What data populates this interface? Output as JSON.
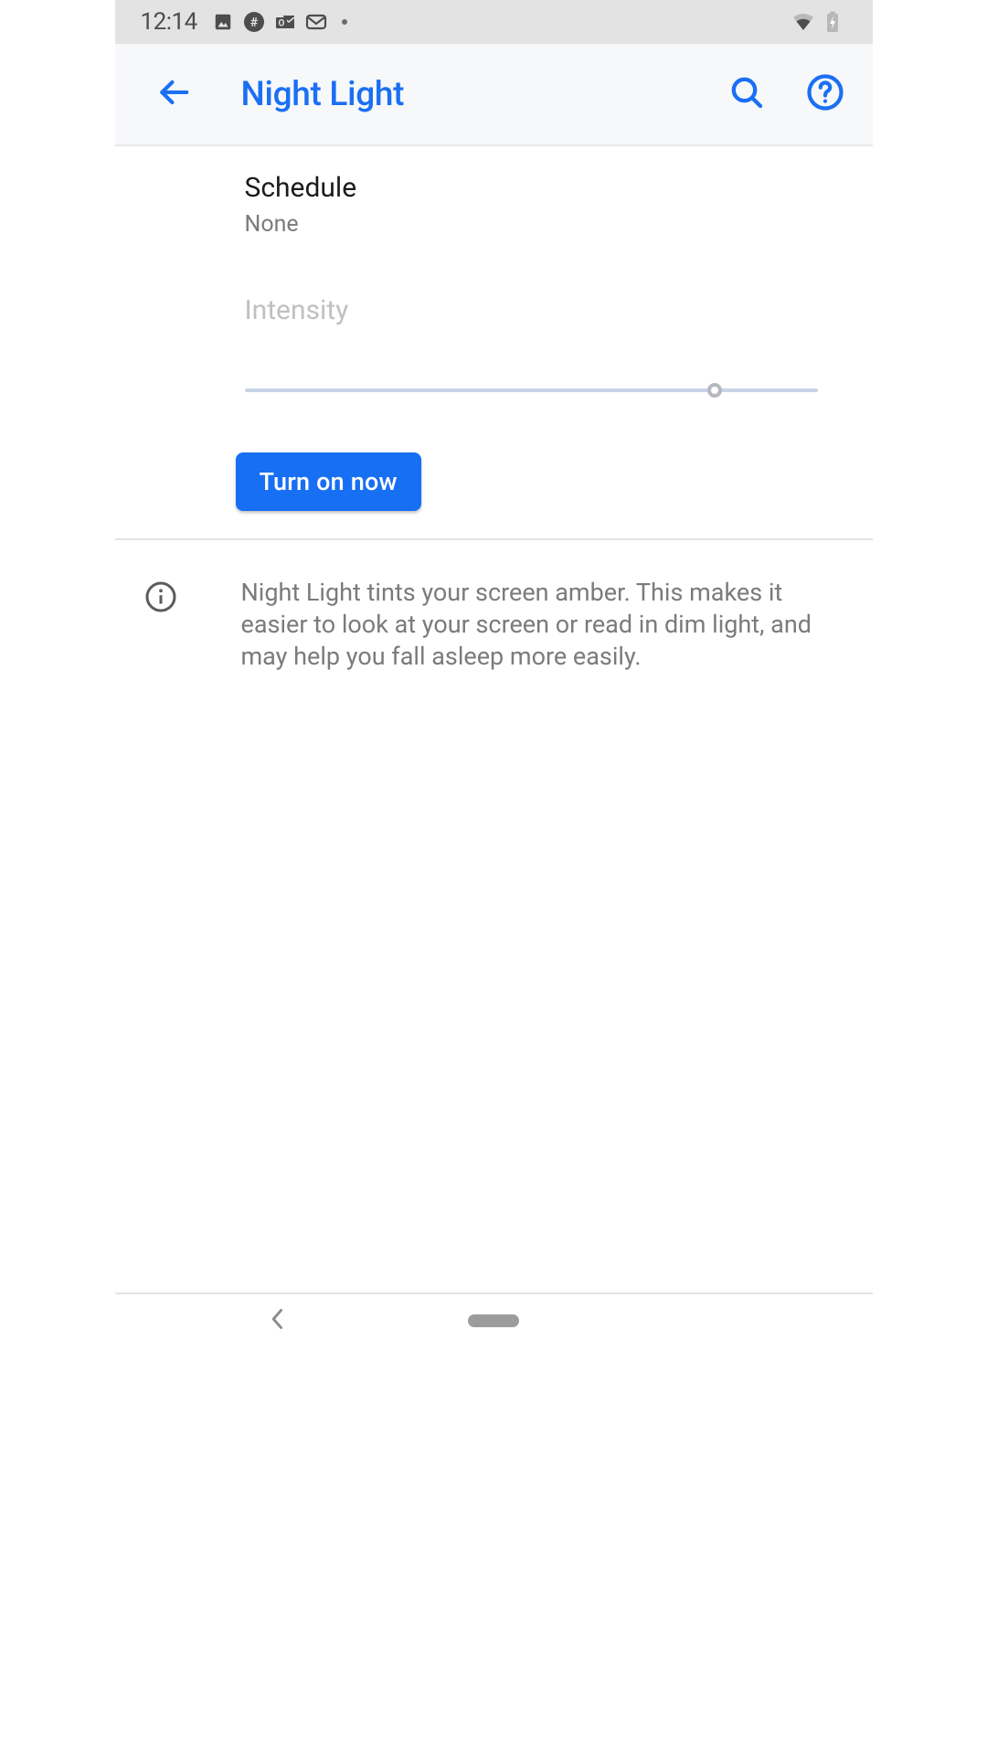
{
  "status_bar": {
    "time": "12:14"
  },
  "app_bar": {
    "title": "Night Light"
  },
  "settings": {
    "schedule_label": "Schedule",
    "schedule_value": "None",
    "intensity_label": "Intensity",
    "intensity_percent": 82,
    "turn_on_button": "Turn on now"
  },
  "info_text": "Night Light tints your screen amber. This makes it easier to look at your screen or read in dim light, and may help you fall asleep more easily.",
  "colors": {
    "accent": "#176ff3"
  }
}
